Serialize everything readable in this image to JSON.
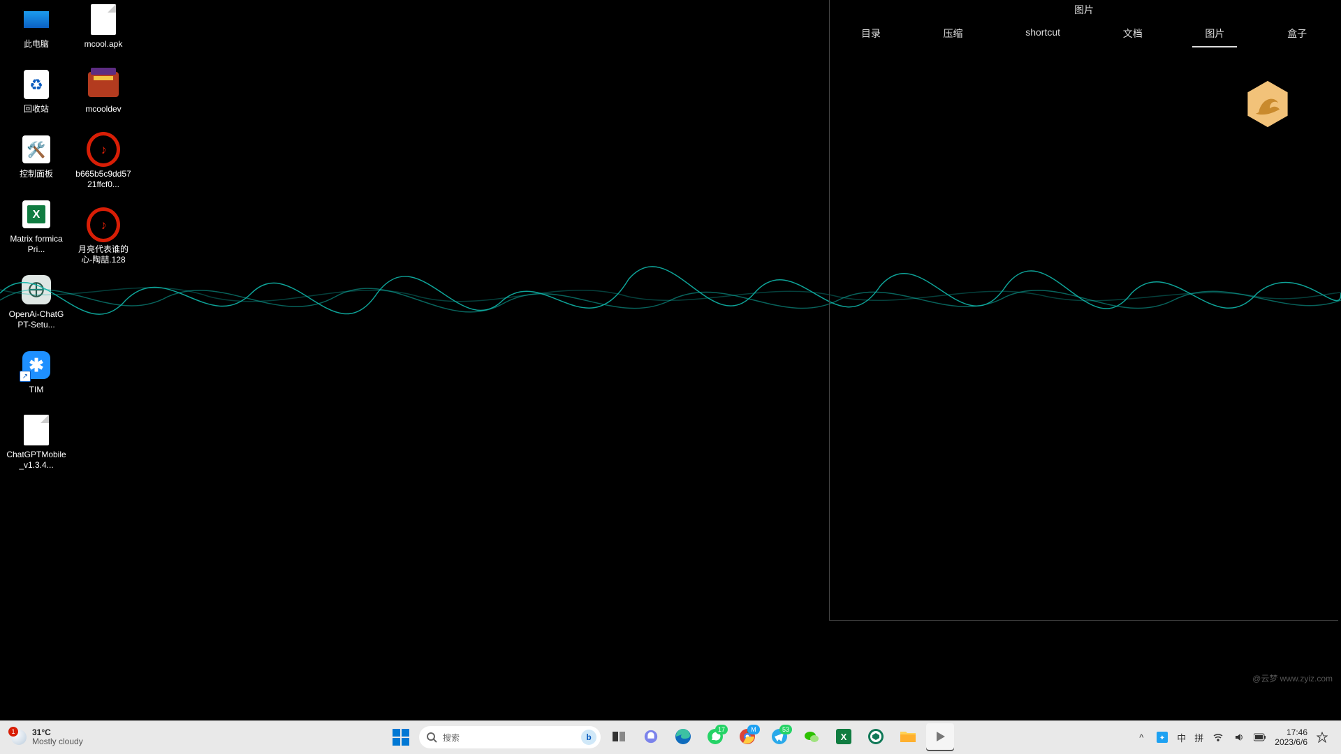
{
  "desktop": {
    "col1": [
      {
        "name": "此电脑",
        "kind": "pc"
      },
      {
        "name": "回收站",
        "kind": "bin"
      },
      {
        "name": "控制面板",
        "kind": "cp"
      },
      {
        "name": "Matrix formica Pri...",
        "kind": "xlsx"
      },
      {
        "name": "OpenAi-ChatGPT-Setu...",
        "kind": "openai"
      },
      {
        "name": "TIM",
        "kind": "tim",
        "shortcut": true
      },
      {
        "name": "ChatGPTMobile_v1.3.4...",
        "kind": "file"
      }
    ],
    "col2": [
      {
        "name": "mcool.apk",
        "kind": "file"
      },
      {
        "name": "mcooldev",
        "kind": "rar"
      },
      {
        "name": "b665b5c9dd5721ffcf0...",
        "kind": "ncm"
      },
      {
        "name": "月亮代表谁的心-陶喆.128",
        "kind": "ncm"
      }
    ]
  },
  "panel": {
    "title": "图片",
    "tabs": [
      "目录",
      "压缩",
      "shortcut",
      "文档",
      "图片",
      "盒子"
    ],
    "active_tab": 4
  },
  "taskbar": {
    "weather": {
      "temp": "31°C",
      "desc": "Mostly cloudy",
      "badge": "1"
    },
    "search_placeholder": "搜索",
    "apps": [
      {
        "id": "start",
        "icon": "win"
      },
      {
        "id": "search",
        "icon": "search"
      },
      {
        "id": "taskview",
        "icon": "taskview"
      },
      {
        "id": "chat",
        "icon": "chat"
      },
      {
        "id": "edge",
        "icon": "edge"
      },
      {
        "id": "whatsapp",
        "icon": "whatsapp",
        "badge": "17"
      },
      {
        "id": "chrome",
        "icon": "chrome",
        "badge_letter": "M"
      },
      {
        "id": "telegram",
        "icon": "telegram",
        "badge": "53"
      },
      {
        "id": "wechat",
        "icon": "wechat"
      },
      {
        "id": "excel",
        "icon": "excel"
      },
      {
        "id": "openai",
        "icon": "openai"
      },
      {
        "id": "explorer",
        "icon": "explorer"
      },
      {
        "id": "mcool",
        "icon": "play",
        "active": true
      }
    ],
    "tray": {
      "overflow": "^",
      "items": [
        "qq",
        "中",
        "拼"
      ],
      "wifi": true,
      "volume": true,
      "battery": true,
      "time": "17:46",
      "date": "2023/6/6"
    }
  },
  "watermark": "@云梦 www.zyiz.com"
}
